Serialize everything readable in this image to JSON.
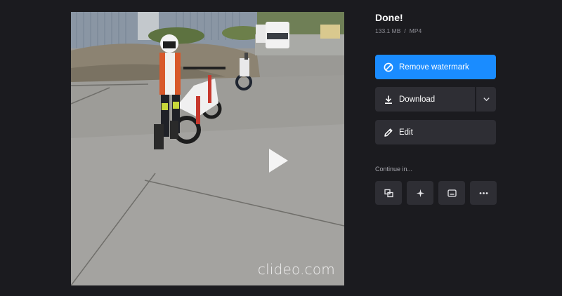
{
  "preview": {
    "watermark": "clideo.com"
  },
  "panel": {
    "title": "Done!",
    "file_size": "133.1 MB",
    "separator": "/",
    "file_format": "MP4",
    "remove_watermark_label": "Remove watermark",
    "download_label": "Download",
    "edit_label": "Edit",
    "continue_label": "Continue in..."
  },
  "colors": {
    "background": "#1b1b1f",
    "primary": "#1a8cff",
    "button_dark": "#2e2e34",
    "muted_text": "#8e8e96"
  },
  "icons": {
    "remove_watermark": "prohibited-circle-icon",
    "download": "download-arrow-icon",
    "dropdown": "chevron-down-icon",
    "edit": "pencil-icon",
    "tools": [
      "merge-icon",
      "sparkle-effects-icon",
      "subtitles-icon",
      "more-dots-icon"
    ],
    "play": "play-icon"
  }
}
